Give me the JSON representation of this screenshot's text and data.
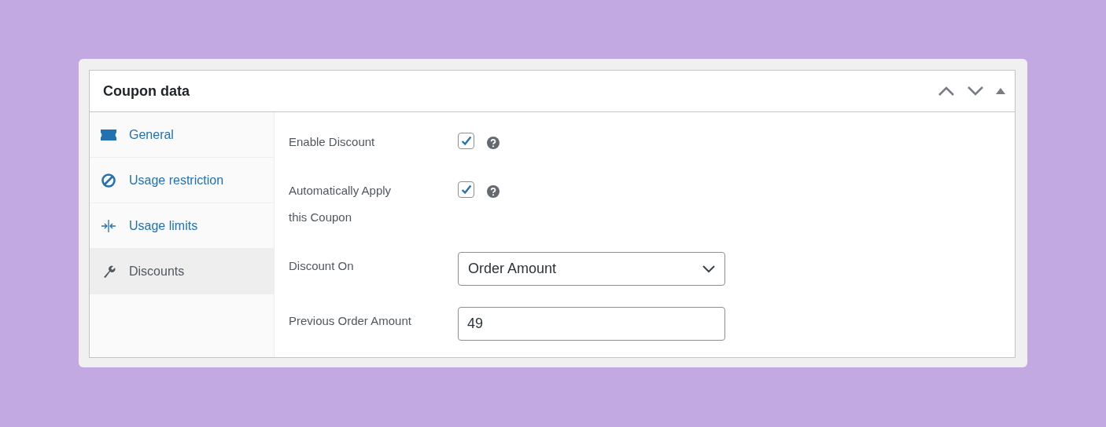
{
  "panel": {
    "title": "Coupon data"
  },
  "tabs": [
    {
      "label": "General",
      "kind": "general",
      "selected": false
    },
    {
      "label": "Usage restriction",
      "kind": "restriction",
      "selected": false
    },
    {
      "label": "Usage limits",
      "kind": "limits",
      "selected": false
    },
    {
      "label": "Discounts",
      "kind": "discounts",
      "selected": true
    }
  ],
  "fields": [
    {
      "kind": "checkbox",
      "label": "Enable Discount",
      "checked": true,
      "help": true
    },
    {
      "kind": "checkbox",
      "label": "Automatically Apply this Coupon",
      "checked": true,
      "help": true
    },
    {
      "kind": "select",
      "label": "Discount On",
      "value": "Order Amount"
    },
    {
      "kind": "text",
      "label": "Previous Order Amount",
      "value": "49"
    }
  ]
}
